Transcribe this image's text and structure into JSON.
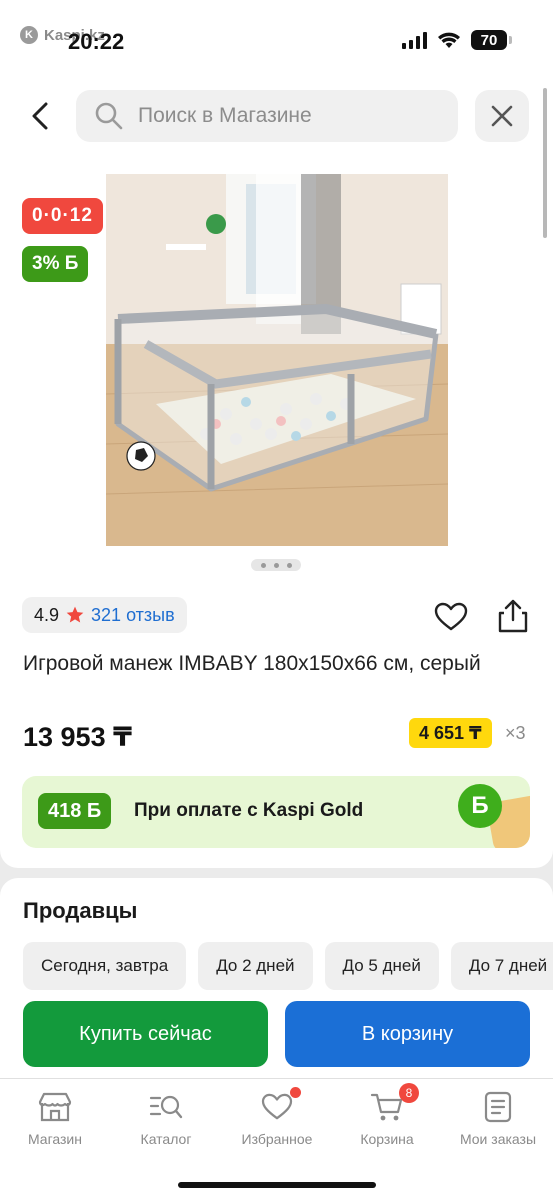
{
  "status_bar": {
    "app_name": "Kaspi.kz",
    "time": "20:22",
    "battery": "70"
  },
  "search": {
    "placeholder": "Поиск в Магазине"
  },
  "badges": {
    "promo": "0·0·12",
    "bonus": "3% Б"
  },
  "rating": {
    "score": "4.9",
    "reviews": "321 отзыв"
  },
  "product": {
    "title": "Игровой манеж IMBABY 180x150x66 см, серый",
    "price": "13 953 ₸",
    "installment_price": "4 651 ₸",
    "installment_multiplier": "×3"
  },
  "kaspi_gold": {
    "bonus": "418 Б",
    "text": "При оплате с Kaspi Gold",
    "b_symbol": "Б"
  },
  "sellers": {
    "title": "Продавцы",
    "filters": [
      "Сегодня, завтра",
      "До 2 дней",
      "До 5 дней",
      "До 7 дней"
    ]
  },
  "actions": {
    "buy_now": "Купить сейчас",
    "add_to_cart": "В корзину"
  },
  "tabbar": {
    "tabs": [
      {
        "label": "Магазин",
        "icon": "shop-icon"
      },
      {
        "label": "Каталог",
        "icon": "catalog-icon"
      },
      {
        "label": "Избранное",
        "icon": "heart-icon"
      },
      {
        "label": "Корзина",
        "icon": "cart-icon",
        "badge": "8"
      },
      {
        "label": "Мои заказы",
        "icon": "orders-icon"
      }
    ]
  },
  "colors": {
    "green": "#3d9a18",
    "red": "#f0483e",
    "blue": "#1b6fd6",
    "buy_green": "#139a3c",
    "yellow": "#ffd80d"
  }
}
